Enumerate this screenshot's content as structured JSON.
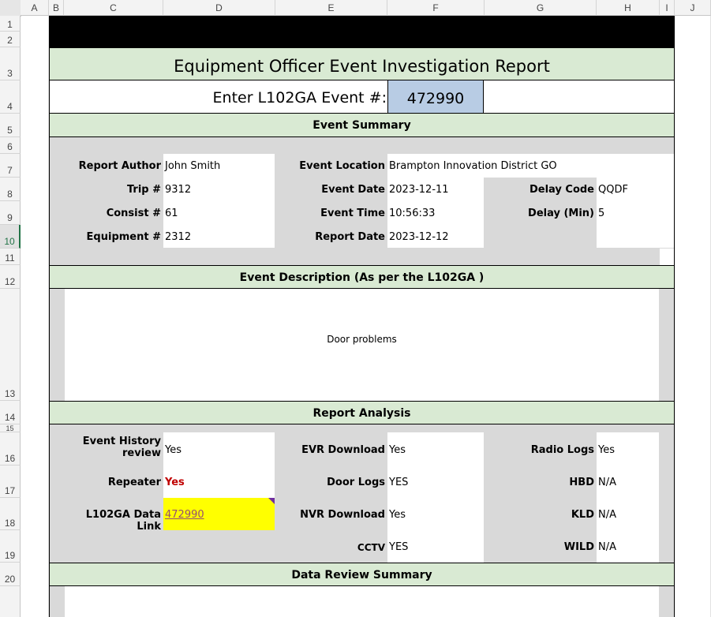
{
  "sheet": {
    "columns": [
      "A",
      "B",
      "C",
      "D",
      "E",
      "F",
      "G",
      "H",
      "I",
      "J"
    ],
    "rows": [
      "1",
      "2",
      "3",
      "4",
      "5",
      "6",
      "7",
      "8",
      "9",
      "10",
      "11",
      "12",
      "13",
      "14",
      "15",
      "16",
      "17",
      "18",
      "19",
      "20"
    ],
    "selected_row": "10"
  },
  "report": {
    "title": "Equipment Officer Event Investigation Report",
    "event_prompt": "Enter L102GA Event #:",
    "event_number": "472990",
    "event_number_bg": "#b8cce4"
  },
  "event_summary": {
    "header": "Event Summary",
    "report_author_label": "Report Author",
    "report_author": "John Smith",
    "trip_label": "Trip #",
    "trip": "9312",
    "consist_label": "Consist #",
    "consist": "61",
    "equipment_label": "Equipment #",
    "equipment": "2312",
    "event_location_label": "Event Location",
    "event_location": "Brampton Innovation District GO",
    "event_date_label": "Event Date",
    "event_date": "2023-12-11",
    "event_time_label": "Event Time",
    "event_time": "10:56:33",
    "report_date_label": "Report Date",
    "report_date": "2023-12-12",
    "delay_code_label": "Delay Code",
    "delay_code": "QQDF",
    "delay_min_label": "Delay (Min)",
    "delay_min": "5"
  },
  "event_description": {
    "header": "Event Description (As per the L102GA )",
    "text": "Door problems"
  },
  "report_analysis": {
    "header": "Report Analysis",
    "event_history_label_1": "Event History",
    "event_history_label_2": "review",
    "event_history": "Yes",
    "repeater_label": "Repeater",
    "repeater": "Yes",
    "repeater_color": "#c00000",
    "data_link_label": "L102GA Data Link",
    "data_link": "472990",
    "data_link_bg": "#ffff00",
    "evr_label": "EVR Download",
    "evr": "Yes",
    "door_logs_label": "Door Logs",
    "door_logs": "YES",
    "nvr_label": "NVR Download",
    "nvr": "Yes",
    "cctv_label": "CCTV",
    "cctv": "YES",
    "radio_logs_label": "Radio Logs",
    "radio_logs": "Yes",
    "hbd_label": "HBD",
    "hbd": "N/A",
    "kld_label": "KLD",
    "kld": "N/A",
    "wild_label": "WILD",
    "wild": "N/A"
  },
  "data_review": {
    "header": "Data Review Summary"
  }
}
